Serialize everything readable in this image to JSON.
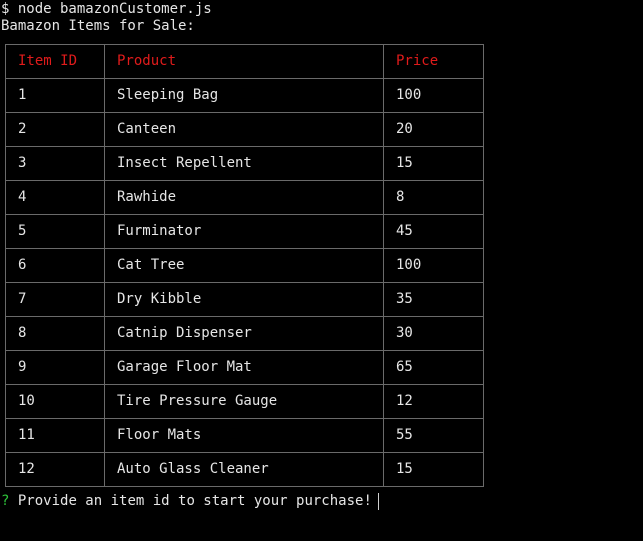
{
  "terminal": {
    "command": "$ node bamazonCustomer.js",
    "heading": "Bamazon Items for Sale:"
  },
  "table": {
    "headers": [
      "Item ID",
      "Product",
      "Price"
    ],
    "rows": [
      [
        "1",
        "Sleeping Bag",
        "100"
      ],
      [
        "2",
        "Canteen",
        "20"
      ],
      [
        "3",
        "Insect Repellent",
        "15"
      ],
      [
        "4",
        "Rawhide",
        "8"
      ],
      [
        "5",
        "Furminator",
        "45"
      ],
      [
        "6",
        "Cat Tree",
        "100"
      ],
      [
        "7",
        "Dry Kibble",
        "35"
      ],
      [
        "8",
        "Catnip Dispenser",
        "30"
      ],
      [
        "9",
        "Garage Floor Mat",
        "65"
      ],
      [
        "10",
        "Tire Pressure Gauge",
        "12"
      ],
      [
        "11",
        "Floor Mats",
        "55"
      ],
      [
        "12",
        "Auto Glass Cleaner",
        "15"
      ]
    ]
  },
  "prompt": {
    "mark": "?",
    "question": "Provide an item id to start your purchase!"
  },
  "colors": {
    "background": "#000000",
    "text": "#e6e6e6",
    "header_text": "#e01b1b",
    "prompt_mark": "#2ec43a",
    "border": "#6a6a6a"
  }
}
